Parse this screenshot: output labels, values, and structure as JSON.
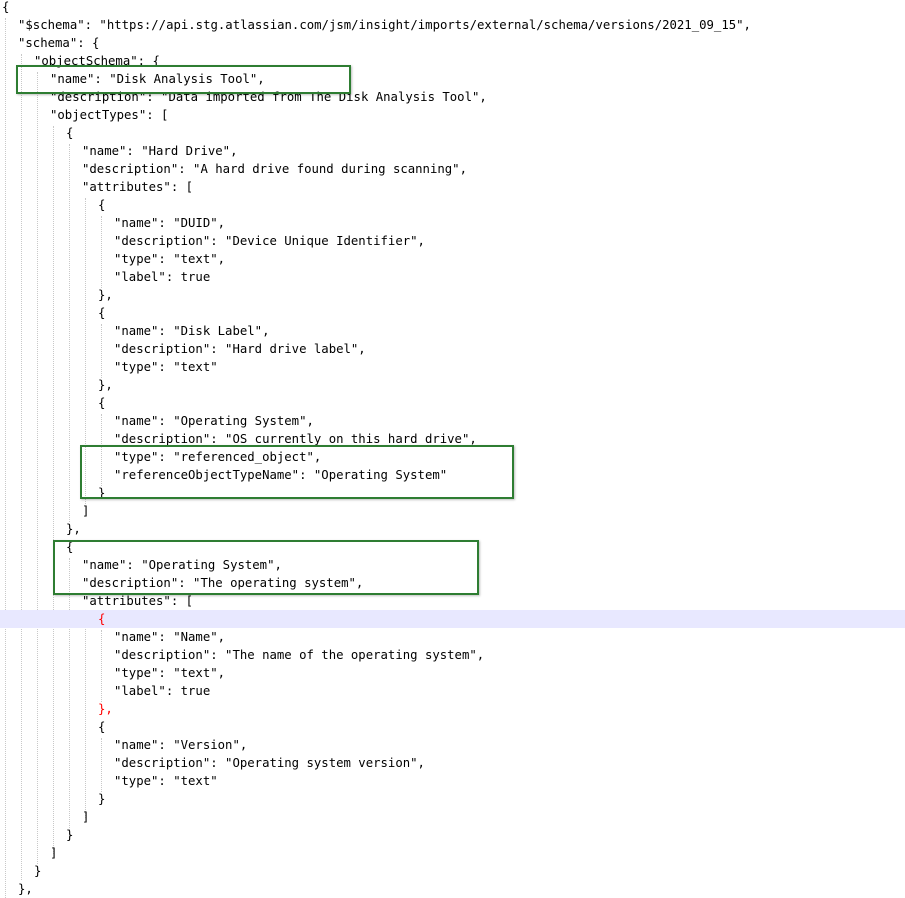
{
  "editor": {
    "current_line_index": 34,
    "highlight_color": "#2e7d32",
    "lines": [
      "{",
      "  \"$schema\": \"https://api.stg.atlassian.com/jsm/insight/imports/external/schema/versions/2021_09_15\",",
      "  \"schema\": {",
      "    \"objectSchema\": {",
      "      \"name\": \"Disk Analysis Tool\",",
      "      \"description\": \"Data imported from The Disk Analysis Tool\",",
      "      \"objectTypes\": [",
      "        {",
      "          \"name\": \"Hard Drive\",",
      "          \"description\": \"A hard drive found during scanning\",",
      "          \"attributes\": [",
      "            {",
      "              \"name\": \"DUID\",",
      "              \"description\": \"Device Unique Identifier\",",
      "              \"type\": \"text\",",
      "              \"label\": true",
      "            },",
      "            {",
      "              \"name\": \"Disk Label\",",
      "              \"description\": \"Hard drive label\",",
      "              \"type\": \"text\"",
      "            },",
      "            {",
      "              \"name\": \"Operating System\",",
      "              \"description\": \"OS currently on this hard drive\",",
      "              \"type\": \"referenced_object\",",
      "              \"referenceObjectTypeName\": \"Operating System\"",
      "            }",
      "          ]",
      "        },",
      "        {",
      "          \"name\": \"Operating System\",",
      "          \"description\": \"The operating system\",",
      "          \"attributes\": [",
      "            {",
      "              \"name\": \"Name\",",
      "              \"description\": \"The name of the operating system\",",
      "              \"type\": \"text\",",
      "              \"label\": true",
      "            },",
      "            {",
      "              \"name\": \"Version\",",
      "              \"description\": \"Operating system version\",",
      "              \"type\": \"text\"",
      "            }",
      "          ]",
      "        }",
      "      ]",
      "    }",
      "  },"
    ]
  }
}
